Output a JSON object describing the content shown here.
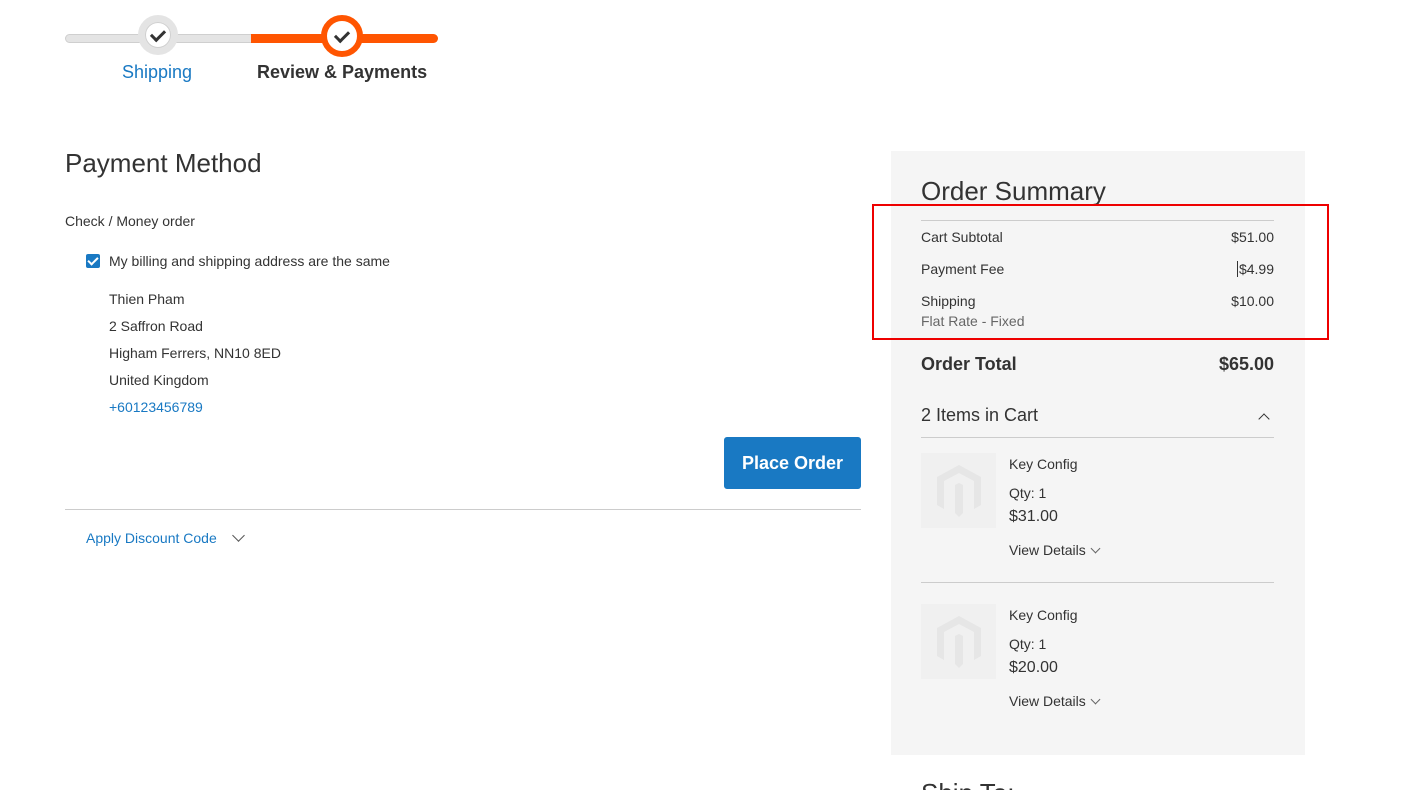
{
  "progress": {
    "steps": [
      {
        "label": "Shipping",
        "status": "complete"
      },
      {
        "label": "Review & Payments",
        "status": "active"
      }
    ],
    "colors": {
      "active": "#ff5501",
      "complete": "#e4e4e4",
      "link": "#1979c3"
    }
  },
  "payment": {
    "title": "Payment Method",
    "method": "Check / Money order",
    "same_address_label": "My billing and shipping address are the same",
    "same_address_checked": true,
    "address": {
      "name": "Thien Pham",
      "street": "2 Saffron Road",
      "city_line": "Higham Ferrers, NN10 8ED",
      "country": "United Kingdom",
      "phone": "+60123456789"
    },
    "place_order_label": "Place Order",
    "discount_label": "Apply Discount Code"
  },
  "summary": {
    "title": "Order Summary",
    "subtotal_label": "Cart Subtotal",
    "subtotal_value": "$51.00",
    "fee_label": "Payment Fee",
    "fee_value": "$4.99",
    "shipping_label": "Shipping",
    "shipping_value": "$10.00",
    "shipping_method": "Flat Rate - Fixed",
    "total_label": "Order Total",
    "total_value": "$65.00",
    "items_heading": "2 Items in Cart",
    "items": [
      {
        "name": "Key Config",
        "qty": "Qty: 1",
        "price": "$31.00",
        "details_label": "View Details"
      },
      {
        "name": "Key Config",
        "qty": "Qty: 1",
        "price": "$20.00",
        "details_label": "View Details"
      }
    ],
    "next_section_partial": "Ship To:"
  },
  "annotation": {
    "color": "#ee0000"
  }
}
